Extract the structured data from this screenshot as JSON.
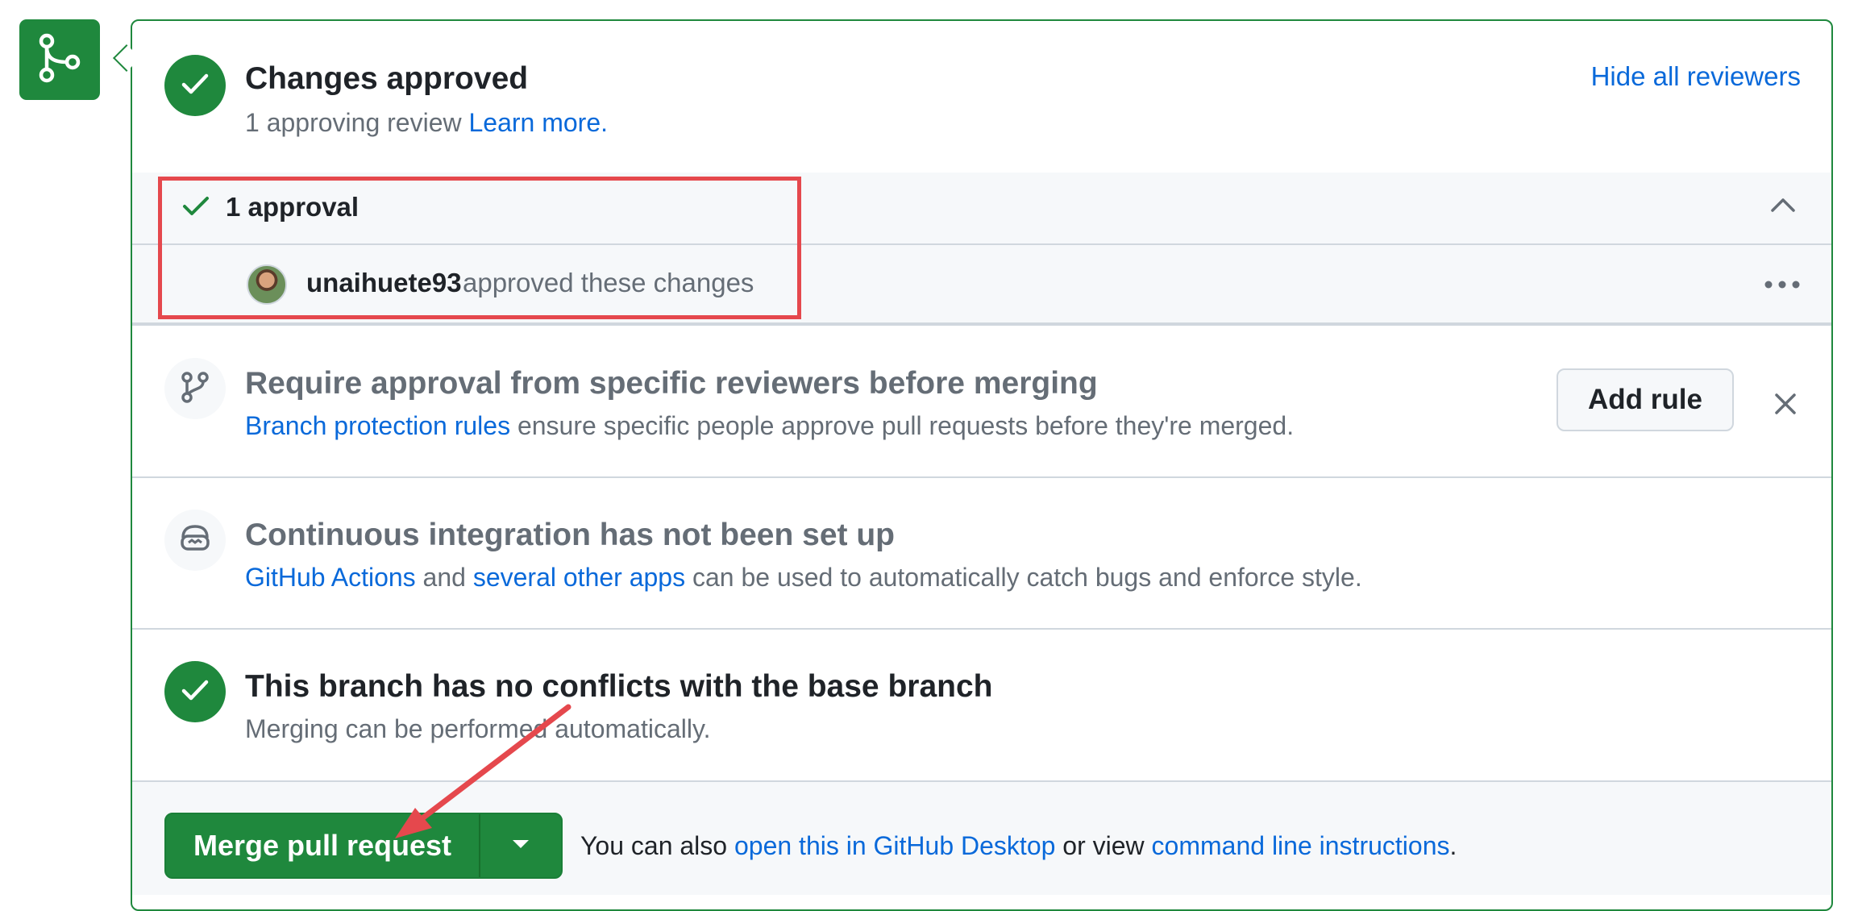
{
  "approval_section": {
    "title": "Changes approved",
    "subtitle_text": "1 approving review",
    "learn_more": "Learn more.",
    "hide_reviewers": "Hide all reviewers",
    "approval_count": "1 approval",
    "reviewer": {
      "username": "unaihuete93",
      "action": "approved these changes"
    }
  },
  "branch_protection": {
    "title": "Require approval from specific reviewers before merging",
    "link": "Branch protection rules",
    "text": "ensure specific people approve pull requests before they're merged.",
    "add_rule_label": "Add rule"
  },
  "ci_section": {
    "title": "Continuous integration has not been set up",
    "link1": "GitHub Actions",
    "and_text": "and",
    "link2": "several other apps",
    "text": "can be used to automatically catch bugs and enforce style."
  },
  "conflicts_section": {
    "title": "This branch has no conflicts with the base branch",
    "subtitle": "Merging can be performed automatically."
  },
  "merge_footer": {
    "merge_button_label": "Merge pull request",
    "prefix_text": "You can also",
    "desktop_link": "open this in GitHub Desktop",
    "or_view_text": "or view",
    "cli_link": "command line instructions",
    "suffix": "."
  },
  "colors": {
    "success_green": "#1f883d",
    "link_blue": "#0969da",
    "annotation_red": "#e5484d",
    "muted_text": "#656d76"
  },
  "icons": [
    "git-merge-icon",
    "check-icon",
    "chevron-up-icon",
    "kebab-horizontal-icon",
    "git-branch-icon",
    "x-icon",
    "copilot-icon",
    "triangle-down-icon"
  ]
}
